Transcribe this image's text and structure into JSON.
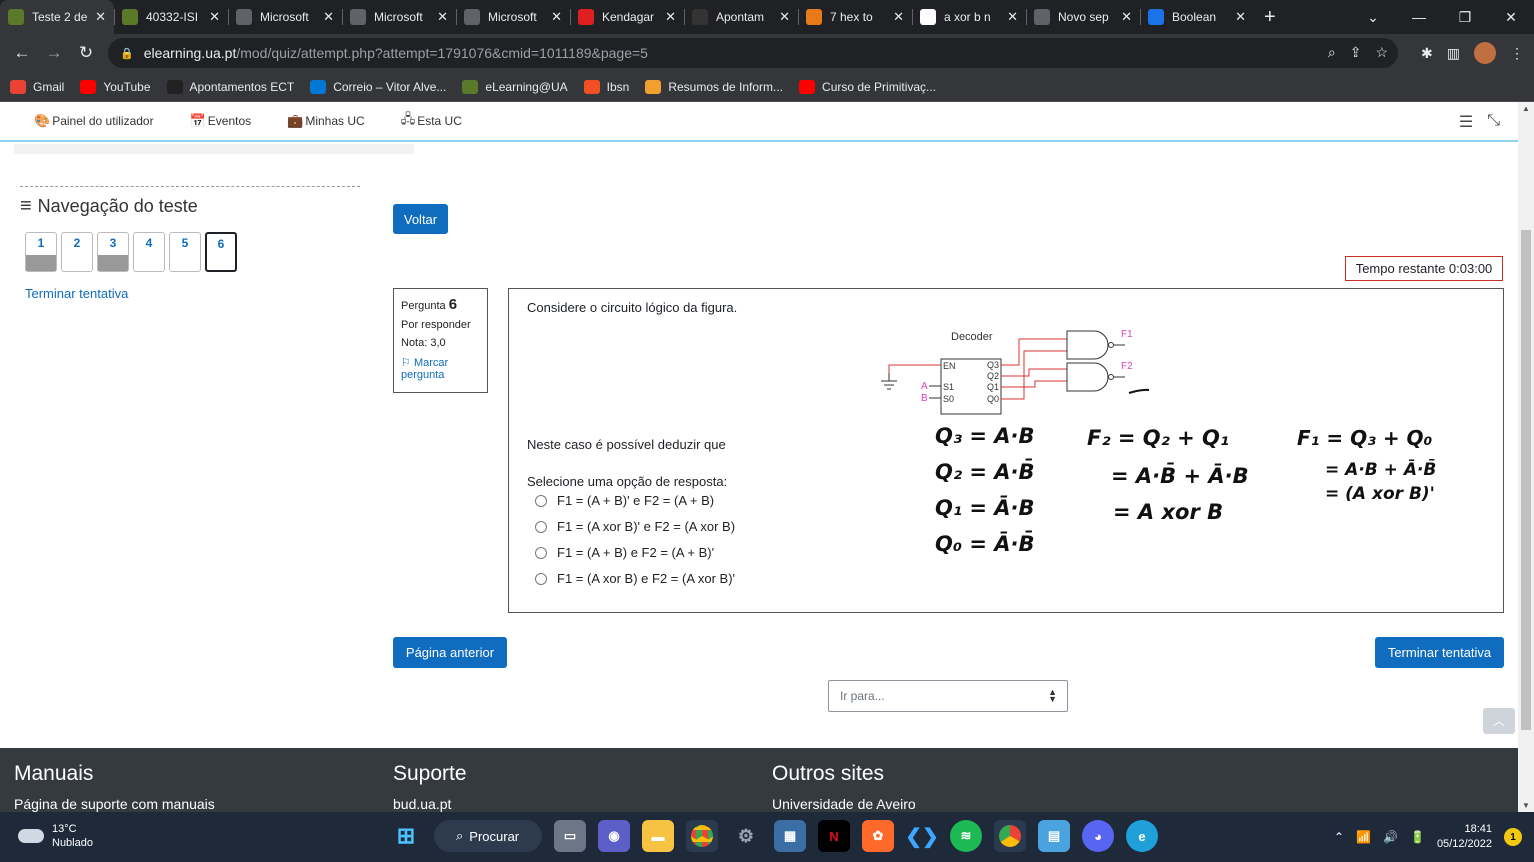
{
  "browser": {
    "tabs": [
      {
        "title": "Teste 2 de",
        "color": "#5a7a2a"
      },
      {
        "title": "40332-ISI",
        "color": "#5a7a2a"
      },
      {
        "title": "Microsoft",
        "color": "#5f6368"
      },
      {
        "title": "Microsoft",
        "color": "#5f6368"
      },
      {
        "title": "Microsoft",
        "color": "#5f6368"
      },
      {
        "title": "Kendagar",
        "color": "#e02020"
      },
      {
        "title": "Apontam",
        "color": "#333333"
      },
      {
        "title": "7 hex to",
        "color": "#e87a1a"
      },
      {
        "title": "a xor b n",
        "color": "#ffffff"
      },
      {
        "title": "Novo sep",
        "color": "#5f6368"
      },
      {
        "title": "Boolean",
        "color": "#1a73e8"
      }
    ],
    "url_host": "elearning.ua.pt",
    "url_path": "/mod/quiz/attempt.php?attempt=1791076&cmid=1011189&page=5",
    "bookmarks": [
      {
        "label": "Gmail",
        "color": "#ea4335"
      },
      {
        "label": "YouTube",
        "color": "#ff0000"
      },
      {
        "label": "Apontamentos ECT",
        "color": "#222222"
      },
      {
        "label": "Correio – Vitor Alve...",
        "color": "#0078d4"
      },
      {
        "label": "eLearning@UA",
        "color": "#5a7a2a"
      },
      {
        "label": "Ibsn",
        "color": "#f25022"
      },
      {
        "label": "Resumos de Inform...",
        "color": "#f0a030"
      },
      {
        "label": "Curso de Primitivaç...",
        "color": "#ff0000"
      }
    ]
  },
  "moodle": {
    "nav": [
      "Painel do utilizador",
      "Eventos",
      "Minhas UC",
      "Esta UC"
    ],
    "quiznav_title": "Navegação do teste",
    "questions": [
      {
        "n": "1",
        "state": "answered"
      },
      {
        "n": "2",
        "state": "empty"
      },
      {
        "n": "3",
        "state": "answered"
      },
      {
        "n": "4",
        "state": "empty"
      },
      {
        "n": "5",
        "state": "empty"
      },
      {
        "n": "6",
        "state": "current"
      }
    ],
    "finish_link": "Terminar tentativa",
    "back_button": "Voltar",
    "timer": "Tempo restante 0:03:00",
    "question": {
      "label": "Pergunta",
      "number": "6",
      "status": "Por responder",
      "grade": "Nota: 3,0",
      "flag": "Marcar pergunta",
      "text": "Considere o circuito lógico da figura.",
      "deduce": "Neste caso é possível deduzir que",
      "prompt": "Selecione uma opção de resposta:",
      "options": [
        "F1 = (A + B)' e F2 = (A + B)",
        "F1 = (A xor B)' e F2 = (A xor B)",
        "F1 = (A + B) e F2 = (A + B)'",
        "F1 = (A xor B) e F2 = (A xor B)'"
      ],
      "circuit": {
        "title": "Decoder",
        "en": "EN",
        "inputs": [
          "S1",
          "S0"
        ],
        "input_names": [
          "A",
          "B"
        ],
        "outputs": [
          "Q3",
          "Q2",
          "Q1",
          "Q0"
        ],
        "gate_outputs": [
          "F1",
          "F2"
        ]
      },
      "handwriting": {
        "q3": "Q₃ = A·B",
        "q2": "Q₂ = A·B̄",
        "q1": "Q₁ = Ā·B",
        "q0": "Q₀ = Ā·B̄",
        "f2_1": "F₂ = Q₂ + Q₁",
        "f2_2": "= A·B̄ + Ā·B",
        "f2_3": "= A xor B",
        "f1_1": "F₁ = Q₃ + Q₀",
        "f1_2": "= A·B + Ā·B̄",
        "f1_3": "= (A xor B)'"
      }
    },
    "prev_button": "Página anterior",
    "finish_button": "Terminar tentativa",
    "jump_select": "Ir para...",
    "footer": [
      {
        "heading": "Manuais",
        "link": "Página de suporte com manuais"
      },
      {
        "heading": "Suporte",
        "link": "bud.ua.pt"
      },
      {
        "heading": "Outros sites",
        "link": "Universidade de Aveiro"
      }
    ]
  },
  "taskbar": {
    "temp": "13°C",
    "weather": "Nublado",
    "search": "Procurar",
    "time": "18:41",
    "date": "05/12/2022",
    "notifications": "1"
  }
}
